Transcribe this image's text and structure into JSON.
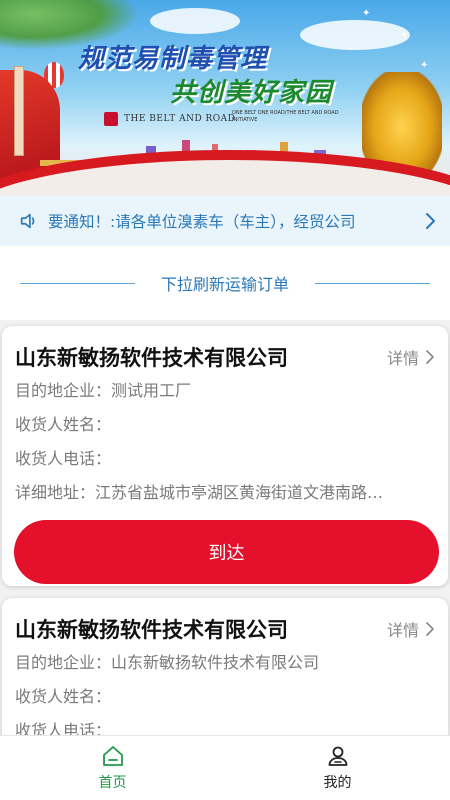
{
  "banner": {
    "slogan_line1": "规范易制毒管理",
    "slogan_line2": "共创美好家园",
    "belt_road": "THE BELT AND ROAD",
    "initiative": "ONE BELT ONE ROAD/THE BELT AND ROAD INITIATIVE"
  },
  "notice": {
    "icon": "speaker-icon",
    "text": "要通知！:请各单位溴素车（车主），经贸公司"
  },
  "section": {
    "title": "下拉刷新运输订单"
  },
  "orders": [
    {
      "company": "山东新敏扬软件技术有限公司",
      "detail_label": "详情",
      "dest_label": "目的地企业：",
      "dest_value": "测试用工厂",
      "receiver_name_label": "收货人姓名：",
      "receiver_name_value": "",
      "receiver_phone_label": "收货人电话：",
      "receiver_phone_value": "",
      "address_label": "详细地址：",
      "address_value": "江苏省盐城市亭湖区黄海街道文港南路…",
      "action_label": "到达"
    },
    {
      "company": "山东新敏扬软件技术有限公司",
      "detail_label": "详情",
      "dest_label": "目的地企业：",
      "dest_value": "山东新敏扬软件技术有限公司",
      "receiver_name_label": "收货人姓名：",
      "receiver_name_value": "",
      "receiver_phone_label": "收货人电话：",
      "receiver_phone_value": ""
    }
  ],
  "tabs": [
    {
      "label": "首页",
      "icon": "home-icon",
      "active": true
    },
    {
      "label": "我的",
      "icon": "user-icon",
      "active": false
    }
  ],
  "colors": {
    "accent_red": "#e5102b",
    "accent_blue": "#2a78b8",
    "active_green": "#1e9a4a"
  }
}
